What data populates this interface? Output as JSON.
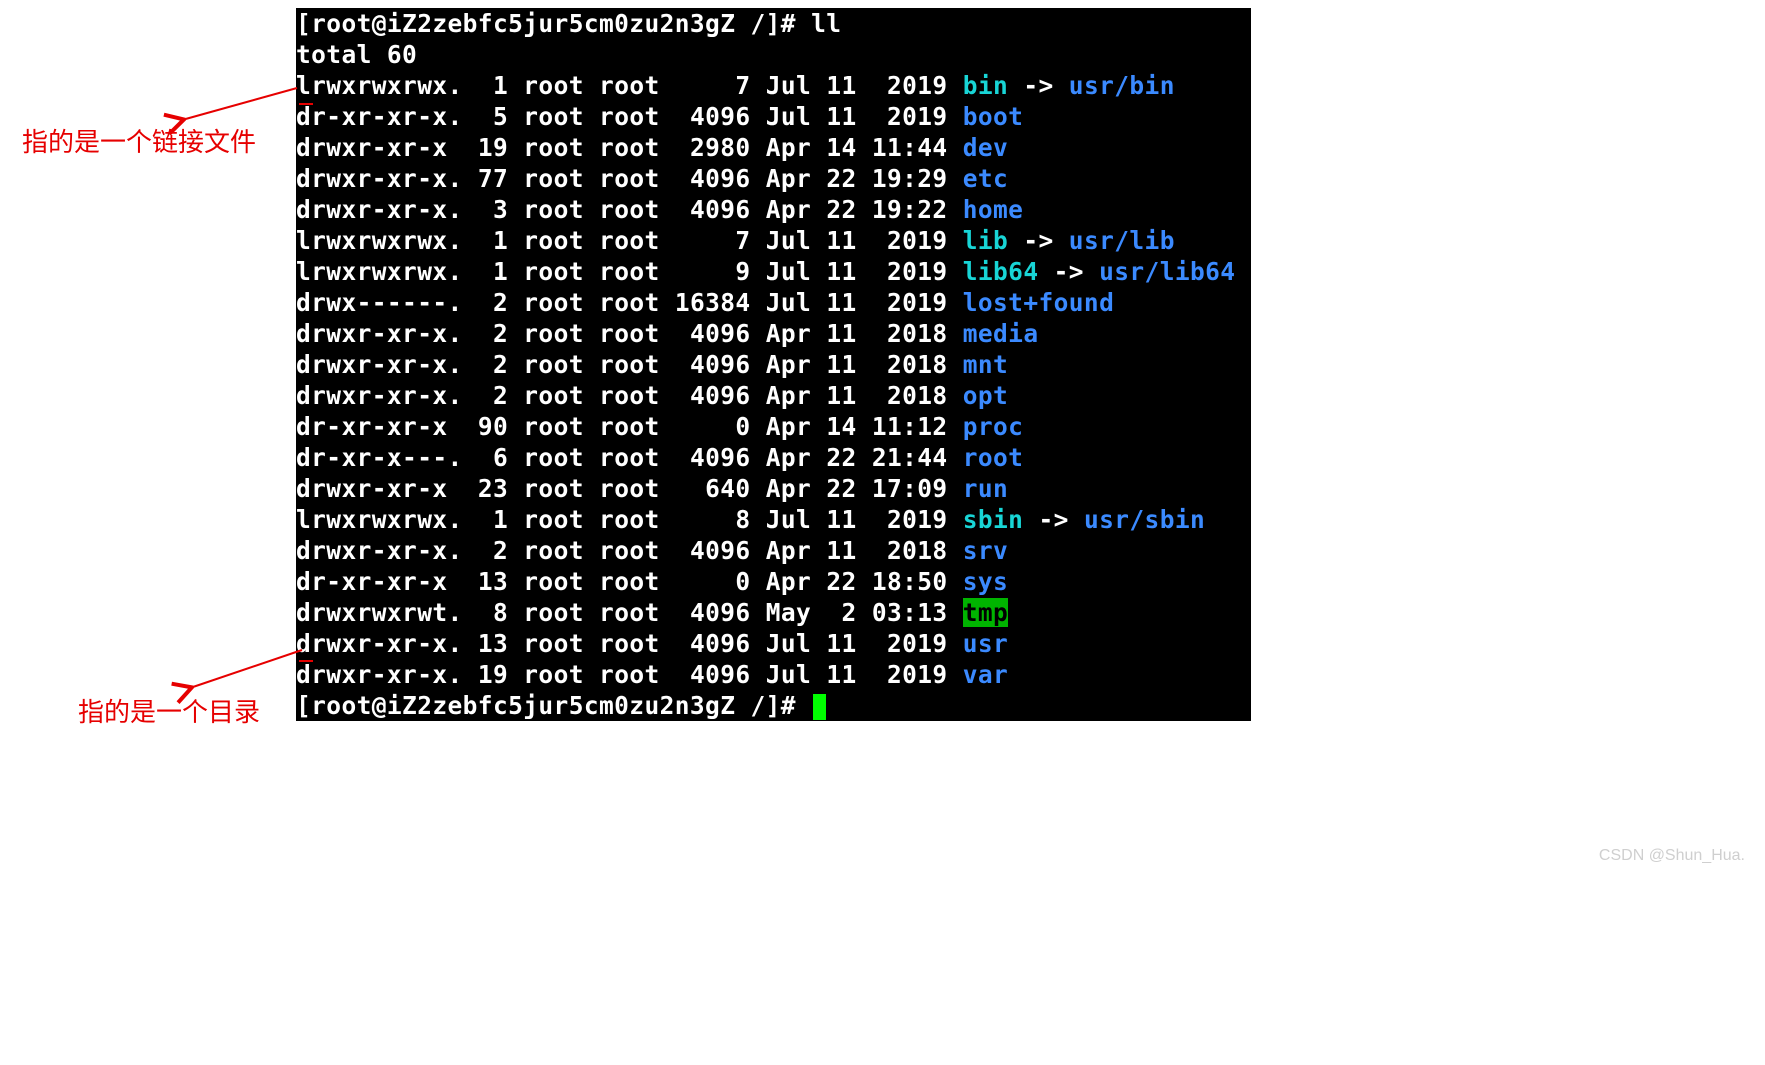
{
  "prompt1": "[root@iZ2zebfc5jur5cm0zu2n3gZ /]# ll",
  "total_line": "total 60",
  "rows": [
    {
      "perm": "lrwxrwxrwx.",
      "links": "1",
      "owner": "root",
      "group": "root",
      "size": "7",
      "month": "Jul",
      "day": "11",
      "time": "2019",
      "name": "bin",
      "type": "link",
      "target": "usr/bin"
    },
    {
      "perm": "dr-xr-xr-x.",
      "links": "5",
      "owner": "root",
      "group": "root",
      "size": "4096",
      "month": "Jul",
      "day": "11",
      "time": "2019",
      "name": "boot",
      "type": "dir"
    },
    {
      "perm": "drwxr-xr-x",
      "links": "19",
      "owner": "root",
      "group": "root",
      "size": "2980",
      "month": "Apr",
      "day": "14",
      "time": "11:44",
      "name": "dev",
      "type": "dir"
    },
    {
      "perm": "drwxr-xr-x.",
      "links": "77",
      "owner": "root",
      "group": "root",
      "size": "4096",
      "month": "Apr",
      "day": "22",
      "time": "19:29",
      "name": "etc",
      "type": "dir"
    },
    {
      "perm": "drwxr-xr-x.",
      "links": "3",
      "owner": "root",
      "group": "root",
      "size": "4096",
      "month": "Apr",
      "day": "22",
      "time": "19:22",
      "name": "home",
      "type": "dir"
    },
    {
      "perm": "lrwxrwxrwx.",
      "links": "1",
      "owner": "root",
      "group": "root",
      "size": "7",
      "month": "Jul",
      "day": "11",
      "time": "2019",
      "name": "lib",
      "type": "link",
      "target": "usr/lib"
    },
    {
      "perm": "lrwxrwxrwx.",
      "links": "1",
      "owner": "root",
      "group": "root",
      "size": "9",
      "month": "Jul",
      "day": "11",
      "time": "2019",
      "name": "lib64",
      "type": "link",
      "target": "usr/lib64"
    },
    {
      "perm": "drwx------.",
      "links": "2",
      "owner": "root",
      "group": "root",
      "size": "16384",
      "month": "Jul",
      "day": "11",
      "time": "2019",
      "name": "lost+found",
      "type": "dir"
    },
    {
      "perm": "drwxr-xr-x.",
      "links": "2",
      "owner": "root",
      "group": "root",
      "size": "4096",
      "month": "Apr",
      "day": "11",
      "time": "2018",
      "name": "media",
      "type": "dir"
    },
    {
      "perm": "drwxr-xr-x.",
      "links": "2",
      "owner": "root",
      "group": "root",
      "size": "4096",
      "month": "Apr",
      "day": "11",
      "time": "2018",
      "name": "mnt",
      "type": "dir"
    },
    {
      "perm": "drwxr-xr-x.",
      "links": "2",
      "owner": "root",
      "group": "root",
      "size": "4096",
      "month": "Apr",
      "day": "11",
      "time": "2018",
      "name": "opt",
      "type": "dir"
    },
    {
      "perm": "dr-xr-xr-x",
      "links": "90",
      "owner": "root",
      "group": "root",
      "size": "0",
      "month": "Apr",
      "day": "14",
      "time": "11:12",
      "name": "proc",
      "type": "dir"
    },
    {
      "perm": "dr-xr-x---.",
      "links": "6",
      "owner": "root",
      "group": "root",
      "size": "4096",
      "month": "Apr",
      "day": "22",
      "time": "21:44",
      "name": "root",
      "type": "dir"
    },
    {
      "perm": "drwxr-xr-x",
      "links": "23",
      "owner": "root",
      "group": "root",
      "size": "640",
      "month": "Apr",
      "day": "22",
      "time": "17:09",
      "name": "run",
      "type": "dir"
    },
    {
      "perm": "lrwxrwxrwx.",
      "links": "1",
      "owner": "root",
      "group": "root",
      "size": "8",
      "month": "Jul",
      "day": "11",
      "time": "2019",
      "name": "sbin",
      "type": "link",
      "target": "usr/sbin"
    },
    {
      "perm": "drwxr-xr-x.",
      "links": "2",
      "owner": "root",
      "group": "root",
      "size": "4096",
      "month": "Apr",
      "day": "11",
      "time": "2018",
      "name": "srv",
      "type": "dir"
    },
    {
      "perm": "dr-xr-xr-x",
      "links": "13",
      "owner": "root",
      "group": "root",
      "size": "0",
      "month": "Apr",
      "day": "22",
      "time": "18:50",
      "name": "sys",
      "type": "dir"
    },
    {
      "perm": "drwxrwxrwt.",
      "links": "8",
      "owner": "root",
      "group": "root",
      "size": "4096",
      "month": "May",
      "day": "2",
      "time": "03:13",
      "name": "tmp",
      "type": "tmp"
    },
    {
      "perm": "drwxr-xr-x.",
      "links": "13",
      "owner": "root",
      "group": "root",
      "size": "4096",
      "month": "Jul",
      "day": "11",
      "time": "2019",
      "name": "usr",
      "type": "dir"
    },
    {
      "perm": "drwxr-xr-x.",
      "links": "19",
      "owner": "root",
      "group": "root",
      "size": "4096",
      "month": "Jul",
      "day": "11",
      "time": "2019",
      "name": "var",
      "type": "dir"
    }
  ],
  "prompt2": "[root@iZ2zebfc5jur5cm0zu2n3gZ /]# ",
  "annotation1": "指的是一个链接文件",
  "annotation2": "指的是一个目录",
  "watermark": "CSDN @Shun_Hua.",
  "link_arrow": " -> ",
  "colors": {
    "terminal_bg": "#000000",
    "text": "#ffffff",
    "dir": "#3b8aff",
    "link": "#18d5d6",
    "tmp_bg": "#00b400",
    "cursor": "#00ff00",
    "anno": "#e60000"
  }
}
